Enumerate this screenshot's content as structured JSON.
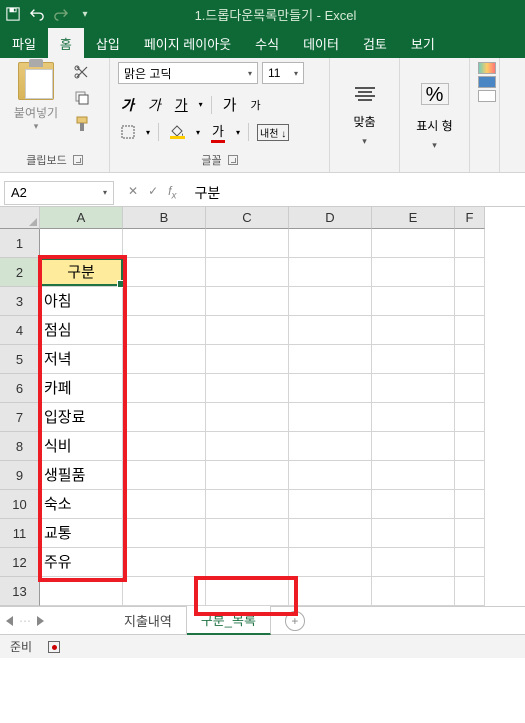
{
  "titlebar": {
    "document_title": "1.드롭다운목록만들기 - Excel"
  },
  "ribbon": {
    "tabs": [
      "파일",
      "홈",
      "삽입",
      "페이지 레이아웃",
      "수식",
      "데이터",
      "검토",
      "보기"
    ],
    "active_tab_index": 1,
    "clipboard": {
      "paste": "붙여넣기",
      "group": "클립보드"
    },
    "font": {
      "name": "맑은 고딕",
      "size": "11",
      "group": "글꼴",
      "bold": "가",
      "italic": "가",
      "underline": "가",
      "fontA": "가",
      "fontAsmall": "가",
      "phonetic": "내천 ↓"
    },
    "alignment": {
      "label": "맞춤"
    },
    "number": {
      "label": "표시 형"
    }
  },
  "namebox": {
    "value": "A2"
  },
  "formulabar": {
    "value": "구분"
  },
  "columns": [
    "A",
    "B",
    "C",
    "D",
    "E",
    "F"
  ],
  "rows_count": 13,
  "active_cell": "A2",
  "cells": {
    "A2": "구분",
    "A3": "아침",
    "A4": "점심",
    "A5": "저녁",
    "A6": "카페",
    "A7": "입장료",
    "A8": "식비",
    "A9": "생필품",
    "A10": "숙소",
    "A11": "교통",
    "A12": "주유"
  },
  "sheets": {
    "tabs": [
      "지출내역",
      "구분_목록"
    ],
    "active_index": 1
  },
  "status": {
    "ready": "준비"
  }
}
